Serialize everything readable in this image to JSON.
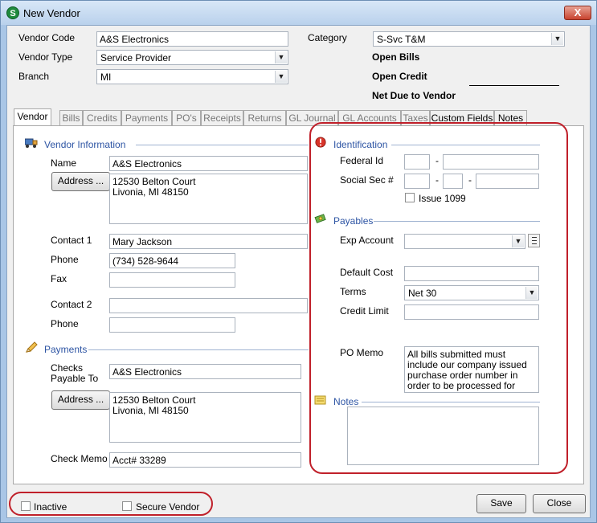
{
  "window": {
    "title": "New Vendor",
    "close_glyph": "X"
  },
  "header": {
    "vendor_code_label": "Vendor Code",
    "vendor_code_value": "A&S Electronics",
    "vendor_type_label": "Vendor Type",
    "vendor_type_value": "Service Provider",
    "branch_label": "Branch",
    "branch_value": "MI",
    "category_label": "Category",
    "category_value": "S-Svc T&M",
    "open_bills_label": "Open Bills",
    "open_credit_label": "Open Credit",
    "net_due_label": "Net Due to Vendor"
  },
  "tabs": [
    "Vendor",
    "Bills",
    "Credits",
    "Payments",
    "PO's",
    "Receipts",
    "Returns",
    "GL Journal",
    "GL Accounts",
    "Taxes",
    "Custom Fields",
    "Notes"
  ],
  "vendor_info": {
    "section_title": "Vendor Information",
    "name_label": "Name",
    "name_value": "A&S Electronics",
    "address_button": "Address ...",
    "address_value": "12530 Belton Court\nLivonia, MI  48150",
    "contact1_label": "Contact 1",
    "contact1_value": "Mary Jackson",
    "phone_label": "Phone",
    "phone_value": "(734) 528-9644",
    "fax_label": "Fax",
    "fax_value": "",
    "contact2_label": "Contact 2",
    "contact2_value": "",
    "phone2_label": "Phone",
    "phone2_value": ""
  },
  "payments": {
    "section_title": "Payments",
    "checks_payable_label": "Checks\nPayable To",
    "checks_payable_value": "A&S Electronics",
    "address_button": "Address ...",
    "address_value": "12530 Belton Court\nLivonia, MI  48150",
    "check_memo_label": "Check Memo",
    "check_memo_value": "Acct# 33289"
  },
  "identification": {
    "section_title": "Identification",
    "federal_id_label": "Federal Id",
    "ssn_label": "Social Sec #",
    "dash": "-",
    "issue_1099_label": "Issue 1099"
  },
  "payables": {
    "section_title": "Payables",
    "exp_account_label": "Exp Account",
    "exp_account_value": "",
    "default_cost_label": "Default Cost",
    "terms_label": "Terms",
    "terms_value": "Net 30",
    "credit_limit_label": "Credit Limit",
    "po_memo_label": "PO Memo",
    "po_memo_value": "All bills submitted must include our company issued purchase order number in order to be processed for payment."
  },
  "notes": {
    "section_title": "Notes",
    "value": ""
  },
  "footer": {
    "inactive_label": "Inactive",
    "secure_vendor_label": "Secure Vendor",
    "save_button": "Save",
    "close_button": "Close"
  },
  "colors": {
    "window_frame": "#a9c6e6",
    "section_title": "#2e55a4",
    "highlight_ring": "#c0202a"
  }
}
